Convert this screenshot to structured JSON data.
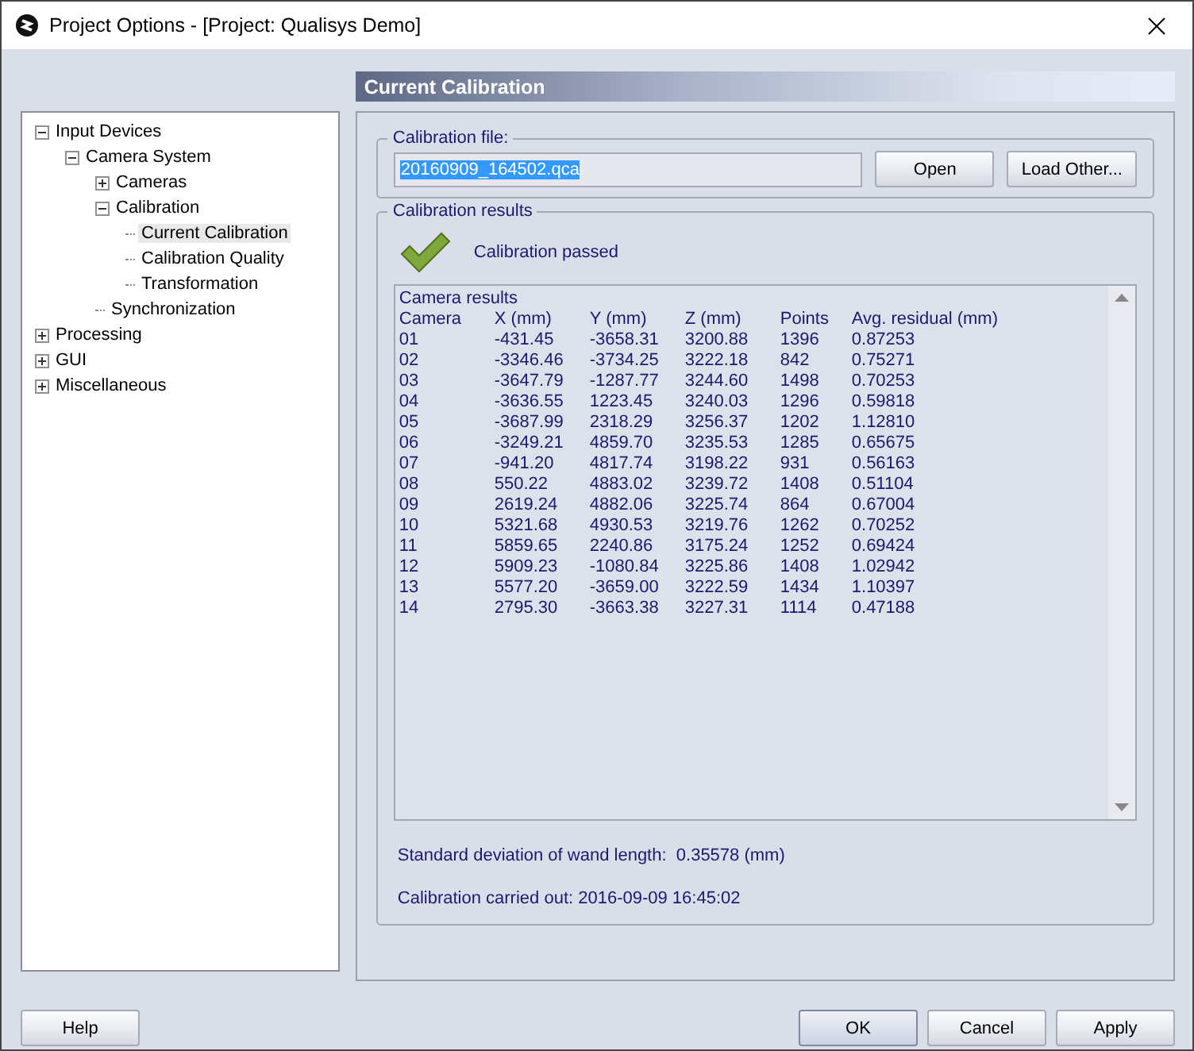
{
  "window": {
    "title": "Project Options - [Project: Qualisys Demo]"
  },
  "tree": [
    {
      "label": "Input Devices",
      "expanded": true,
      "selected": false,
      "children": [
        {
          "label": "Camera System",
          "expanded": true,
          "selected": false,
          "children": [
            {
              "label": "Cameras",
              "expanded": false,
              "selected": false
            },
            {
              "label": "Calibration",
              "expanded": true,
              "selected": false,
              "children": [
                {
                  "label": "Current Calibration",
                  "selected": true
                },
                {
                  "label": "Calibration Quality",
                  "selected": false
                },
                {
                  "label": "Transformation",
                  "selected": false
                }
              ]
            },
            {
              "label": "Synchronization",
              "selected": false
            }
          ]
        }
      ]
    },
    {
      "label": "Processing",
      "expanded": false,
      "selected": false
    },
    {
      "label": "GUI",
      "expanded": false,
      "selected": false
    },
    {
      "label": "Miscellaneous",
      "expanded": false,
      "selected": false
    }
  ],
  "page_title": "Current Calibration",
  "calibration_file": {
    "legend": "Calibration file:",
    "value": "20160909_164502.qca",
    "buttons": [
      "Open",
      "Load Other..."
    ]
  },
  "results": {
    "legend": "Calibration results",
    "status": "Calibration passed",
    "table": {
      "title": "Camera results",
      "columns": [
        "Camera",
        "X (mm)",
        "Y (mm)",
        "Z (mm)",
        "Points",
        "Avg. residual (mm)"
      ],
      "rows": [
        [
          "01",
          "-431.45",
          "-3658.31",
          "3200.88",
          "1396",
          "0.87253"
        ],
        [
          "02",
          "-3346.46",
          "-3734.25",
          "3222.18",
          "842",
          "0.75271"
        ],
        [
          "03",
          "-3647.79",
          "-1287.77",
          "3244.60",
          "1498",
          "0.70253"
        ],
        [
          "04",
          "-3636.55",
          "1223.45",
          "3240.03",
          "1296",
          "0.59818"
        ],
        [
          "05",
          "-3687.99",
          "2318.29",
          "3256.37",
          "1202",
          "1.12810"
        ],
        [
          "06",
          "-3249.21",
          "4859.70",
          "3235.53",
          "1285",
          "0.65675"
        ],
        [
          "07",
          "-941.20",
          "4817.74",
          "3198.22",
          "931",
          "0.56163"
        ],
        [
          "08",
          "550.22",
          "4883.02",
          "3239.72",
          "1408",
          "0.51104"
        ],
        [
          "09",
          "2619.24",
          "4882.06",
          "3225.74",
          "864",
          "0.67004"
        ],
        [
          "10",
          "5321.68",
          "4930.53",
          "3219.76",
          "1262",
          "0.70252"
        ],
        [
          "11",
          "5859.65",
          "2240.86",
          "3175.24",
          "1252",
          "0.69424"
        ],
        [
          "12",
          "5909.23",
          "-1080.84",
          "3225.86",
          "1408",
          "1.02942"
        ],
        [
          "13",
          "5577.20",
          "-3659.00",
          "3222.59",
          "1434",
          "1.10397"
        ],
        [
          "14",
          "2795.30",
          "-3663.38",
          "3227.31",
          "1114",
          "0.47188"
        ]
      ]
    },
    "std_dev": "Standard deviation of wand length:  0.35578 (mm)",
    "carried_out": "Calibration carried out: 2016-09-09 16:45:02"
  },
  "left_buttons": [
    "Help"
  ],
  "buttons": [
    "OK",
    "Cancel",
    "Apply"
  ]
}
